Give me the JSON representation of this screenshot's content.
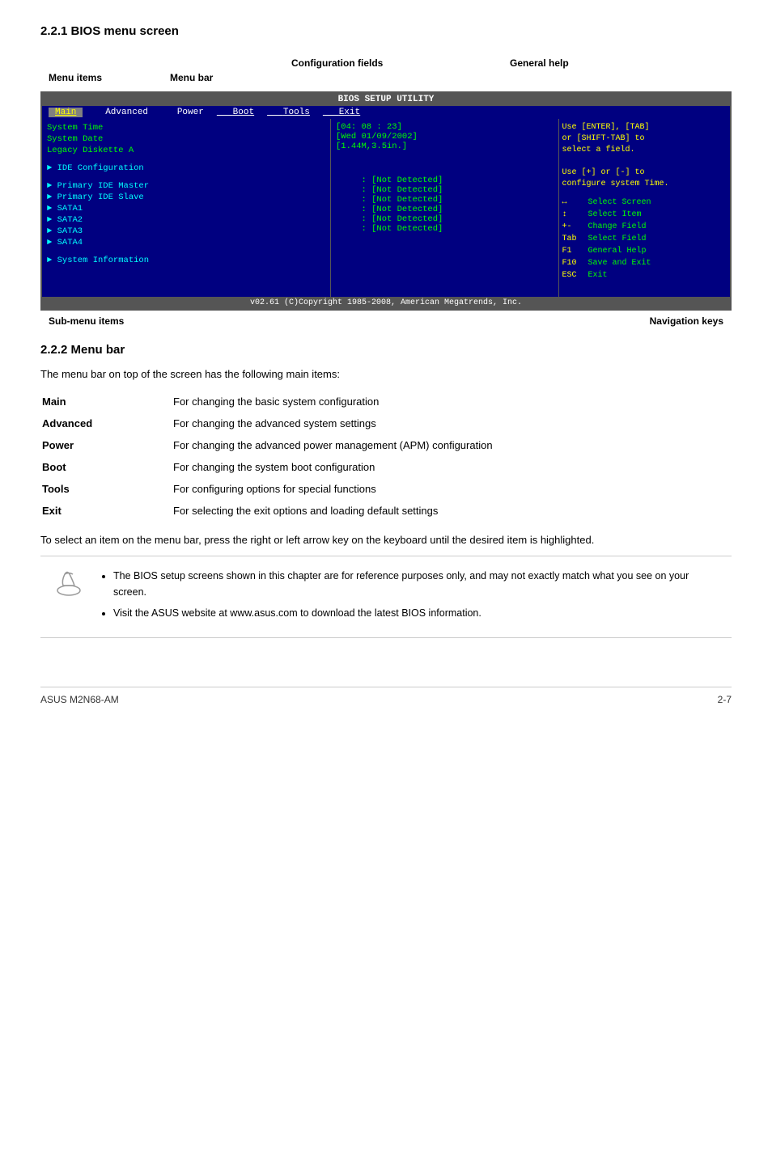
{
  "page": {
    "section_221_title": "2.2.1    BIOS menu screen",
    "section_222_title": "2.2.2    Menu bar",
    "footer_left": "ASUS M2N68-AM",
    "footer_right": "2-7"
  },
  "diagram": {
    "label_menu_items": "Menu items",
    "label_menu_bar": "Menu bar",
    "label_config_fields": "Configuration fields",
    "label_general_help": "General help",
    "label_sub_menu": "Sub-menu items",
    "label_nav_keys": "Navigation keys"
  },
  "bios": {
    "header": "BIOS SETUP UTILITY",
    "menubar": [
      "Main",
      "Advanced",
      "Power",
      "Boot",
      "Tools",
      "Exit"
    ],
    "menubar_active": "Main",
    "menubar_underline": [
      "Boot",
      "Tools",
      "Exit"
    ],
    "left_panel": {
      "items": [
        {
          "type": "header",
          "text": "System Time"
        },
        {
          "type": "header",
          "text": "System Date"
        },
        {
          "type": "header",
          "text": "Legacy Diskette A"
        },
        {
          "type": "spacer"
        },
        {
          "type": "submenu",
          "text": "IDE Configuration"
        },
        {
          "type": "spacer"
        },
        {
          "type": "submenu",
          "text": "Primary IDE Master"
        },
        {
          "type": "submenu",
          "text": "Primary IDE Slave"
        },
        {
          "type": "submenu",
          "text": "SATA1"
        },
        {
          "type": "submenu",
          "text": "SATA2"
        },
        {
          "type": "submenu",
          "text": "SATA3"
        },
        {
          "type": "submenu",
          "text": "SATA4"
        },
        {
          "type": "spacer"
        },
        {
          "type": "submenu",
          "text": "System Information"
        }
      ]
    },
    "center_panel": {
      "items": [
        {
          "label": "",
          "value": "[04: 08 : 23]"
        },
        {
          "label": "",
          "value": "[Wed 01/09/2002]"
        },
        {
          "label": "",
          "value": "[1.44M,3.5in.]"
        },
        {
          "label": "",
          "value": ""
        },
        {
          "label": "",
          "value": ""
        },
        {
          "label": "",
          "value": ""
        },
        {
          "label": ": ",
          "value": "[Not Detected]"
        },
        {
          "label": ": ",
          "value": "[Not Detected]"
        },
        {
          "label": ": ",
          "value": "[Not Detected]"
        },
        {
          "label": ": ",
          "value": "[Not Detected]"
        },
        {
          "label": ": ",
          "value": "[Not Detected]"
        },
        {
          "label": ": ",
          "value": "[Not Detected]"
        }
      ]
    },
    "right_panel": {
      "help_lines": [
        "Use [ENTER], [TAB]",
        "or [SHIFT-TAB] to",
        "select a field.",
        "",
        "Use [+] or [-] to",
        "configure system Time."
      ],
      "nav_items": [
        {
          "key": "↔",
          "desc": "Select Screen"
        },
        {
          "key": "↕",
          "desc": "Select Item"
        },
        {
          "key": "+-",
          "desc": "Change Field"
        },
        {
          "key": "Tab",
          "desc": "Select Field"
        },
        {
          "key": "F1",
          "desc": "General Help"
        },
        {
          "key": "F10",
          "desc": "Save and Exit"
        },
        {
          "key": "ESC",
          "desc": "Exit"
        }
      ]
    },
    "footer": "v02.61  (C)Copyright 1985-2008, American Megatrends, Inc."
  },
  "section222": {
    "intro": "The menu bar on top of the screen has the following main items:",
    "items": [
      {
        "term": "Main",
        "desc": "For changing the basic system configuration"
      },
      {
        "term": "Advanced",
        "desc": "For changing the advanced system settings"
      },
      {
        "term": "Power",
        "desc": "For changing the advanced power management (APM) configuration"
      },
      {
        "term": "Boot",
        "desc": "For changing the system boot configuration"
      },
      {
        "term": "Tools",
        "desc": "For configuring options for special functions"
      },
      {
        "term": "Exit",
        "desc": "For selecting the exit options and loading default settings"
      }
    ],
    "note_para": "To select an item on the menu bar, press the right or left arrow key on the keyboard until the desired item is highlighted.",
    "notes": [
      "The BIOS setup screens shown in this chapter are for reference purposes only, and may not exactly match what you see on your screen.",
      "Visit the ASUS website at www.asus.com to download the latest BIOS information."
    ]
  }
}
